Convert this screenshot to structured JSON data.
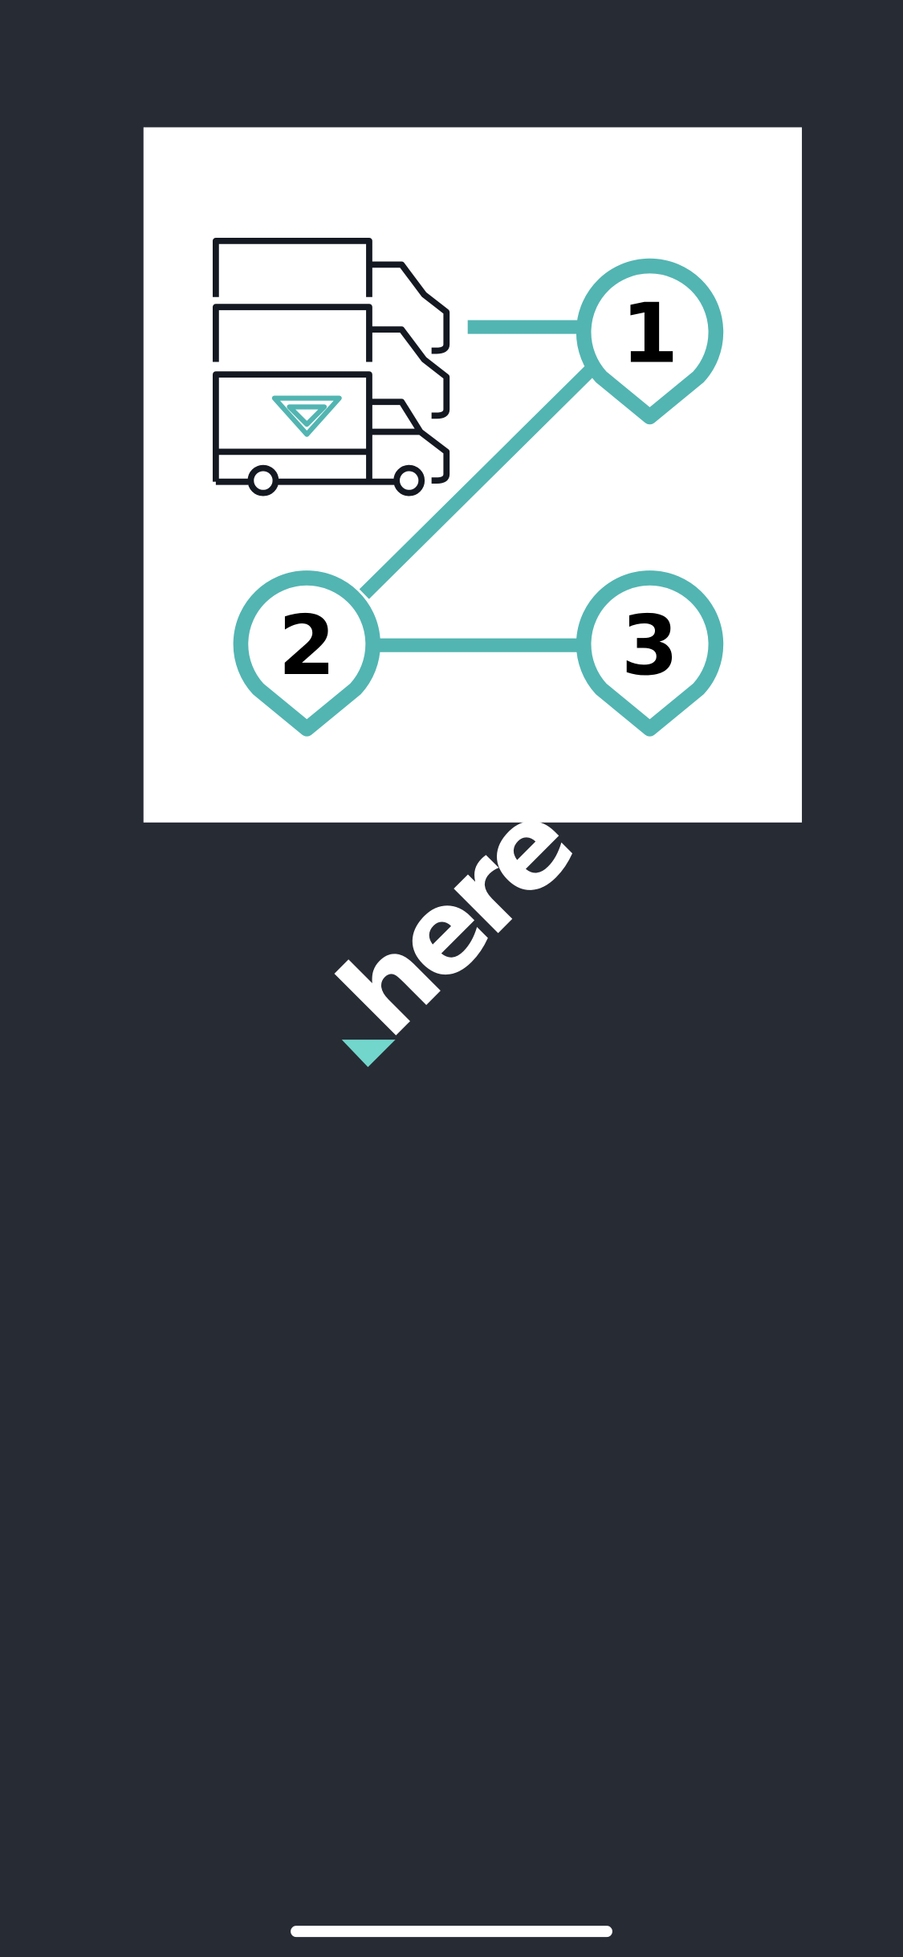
{
  "splash": {
    "background_color": "#272b34",
    "illustration": {
      "name": "route-planning-illustration",
      "background_color": "#ffffff",
      "accent_color": "#52b5b2",
      "ink_color": "#141821",
      "stops": [
        {
          "label": "1"
        },
        {
          "label": "2"
        },
        {
          "label": "3"
        }
      ],
      "vehicles_icon": "delivery-trucks-icon"
    },
    "logo": {
      "text": "here",
      "text_color": "#ffffff",
      "accent_color": "#72d6cc"
    },
    "home_indicator_color": "#ffffff"
  }
}
